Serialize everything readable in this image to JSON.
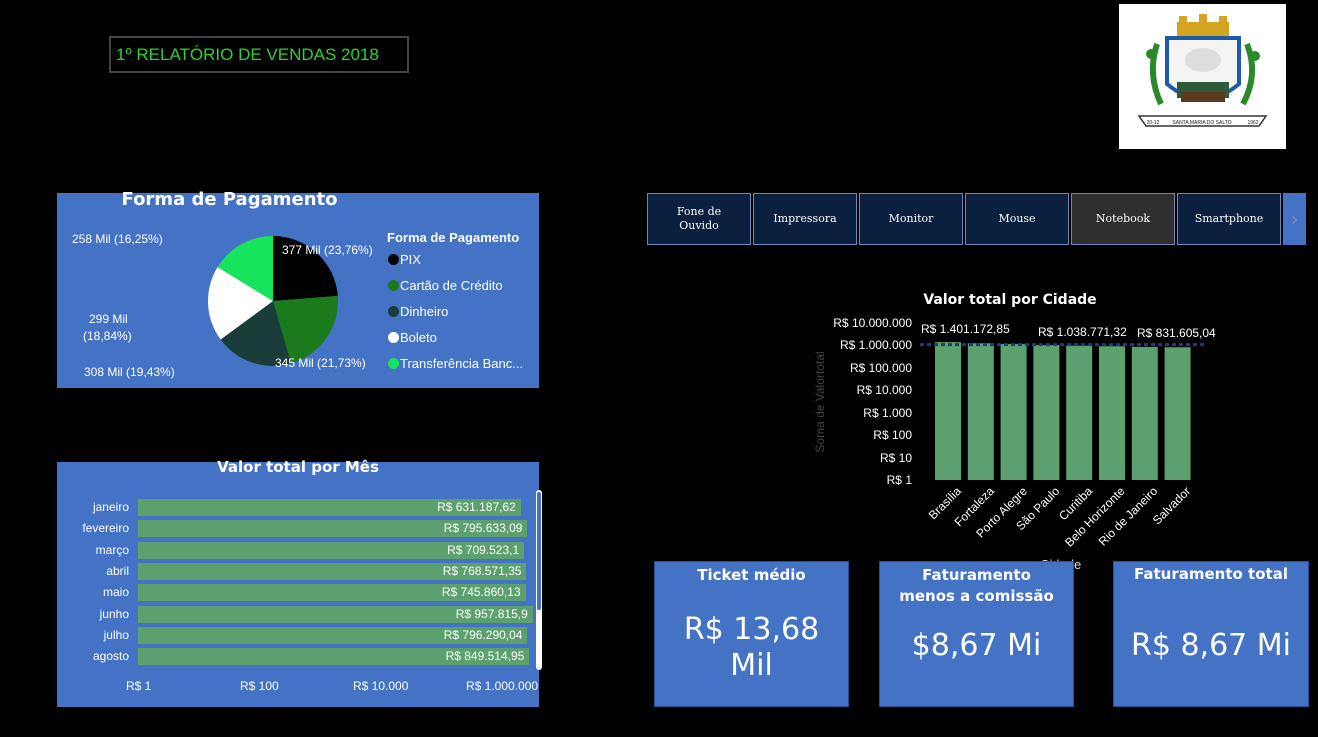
{
  "header": {
    "title": "1º RELATÓRIO DE VENDAS 2018"
  },
  "logo": {
    "motto": "SANTA MARIA DO SALTO",
    "year_left": "20-12",
    "year_right": "1962"
  },
  "payment": {
    "title": "Forma de Pagamento",
    "legend_title": "Forma de Pagamento",
    "legend": [
      {
        "label": "PIX",
        "color": "#000000"
      },
      {
        "label": "Cartão de Crédito",
        "color": "#1b7a1b"
      },
      {
        "label": "Dinheiro",
        "color": "#1a3d3a"
      },
      {
        "label": "Boleto",
        "color": "#ffffff"
      },
      {
        "label": "Transferência Banc...",
        "color": "#16e45a"
      }
    ],
    "slice_labels": [
      "377 Mil (23,76%)",
      "345 Mil (21,73%)",
      "308 Mil (19,43%)",
      "299 Mil",
      "(18,84%)",
      "258 Mil (16,25%)"
    ]
  },
  "filters": {
    "items": [
      "Fone de\nOuvido",
      "Impressora",
      "Monitor",
      "Mouse",
      "Notebook",
      "Smartphone"
    ],
    "active": "Notebook",
    "next_icon": "chevron-right-icon"
  },
  "month_chart": {
    "title": "Valor total por Mês",
    "axis_ticks": [
      "R$ 1",
      "R$ 100",
      "R$ 10.000",
      "R$ 1.000.000"
    ]
  },
  "city_chart": {
    "title": "Valor total por Cidade",
    "ylabel": "Soma de Valortotal",
    "xlabel": "Cidade",
    "y_ticks": [
      "R$ 10.000.000",
      "R$ 1.000.000",
      "R$ 100.000",
      "R$ 10.000",
      "R$ 1.000",
      "R$ 100",
      "R$ 10",
      "R$ 1"
    ],
    "data_labels": [
      "R$ 1.401.172,85",
      "R$ 1.038.771,32",
      "R$ 831.605,04"
    ]
  },
  "kpis": [
    {
      "title": "Ticket médio",
      "value_line1": "R$ 13,68",
      "value_line2": "Mil"
    },
    {
      "title_line1": "Faturamento",
      "title_line2": "menos a comissão",
      "value": "$8,67 Mi"
    },
    {
      "title": "Faturamento total",
      "value": "R$ 8,67 Mi"
    }
  ],
  "chart_data": [
    {
      "type": "pie",
      "title": "Forma de Pagamento",
      "categories": [
        "PIX",
        "Cartão de Crédito",
        "Dinheiro",
        "Boleto",
        "Transferência Bancária"
      ],
      "values": [
        377,
        345,
        308,
        299,
        258
      ],
      "percentages": [
        23.76,
        21.73,
        19.43,
        18.84,
        16.25
      ],
      "unit": "Mil",
      "legend": "right"
    },
    {
      "type": "bar",
      "orientation": "horizontal",
      "title": "Valor total por Mês",
      "scale": "log",
      "categories": [
        "janeiro",
        "fevereiro",
        "março",
        "abril",
        "maio",
        "junho",
        "julho",
        "agosto"
      ],
      "values": [
        631187.62,
        795633.09,
        709523.1,
        768571.35,
        745860.13,
        957815.9,
        796290.04,
        849514.95
      ],
      "value_labels": [
        "R$ 631.187,62",
        "R$ 795.633,09",
        "R$ 709.523,1",
        "R$ 768.571,35",
        "R$ 745.860,13",
        "R$ 957.815,9",
        "R$ 796.290,04",
        "R$ 849.514,95"
      ],
      "xlim": [
        1,
        1000000
      ]
    },
    {
      "type": "bar",
      "title": "Valor total por Cidade",
      "scale": "log",
      "xlabel": "Cidade",
      "ylabel": "Soma de Valortotal",
      "categories": [
        "Brasília",
        "Fortaleza",
        "Porto Alegre",
        "São Paulo",
        "Curitiba",
        "Belo Horizonte",
        "Rio de Janeiro",
        "Salvador"
      ],
      "values": [
        1401172.85,
        1250000,
        1150000,
        1038771.32,
        980000,
        920000,
        860000,
        831605.04
      ],
      "ylim": [
        1,
        10000000
      ]
    }
  ]
}
